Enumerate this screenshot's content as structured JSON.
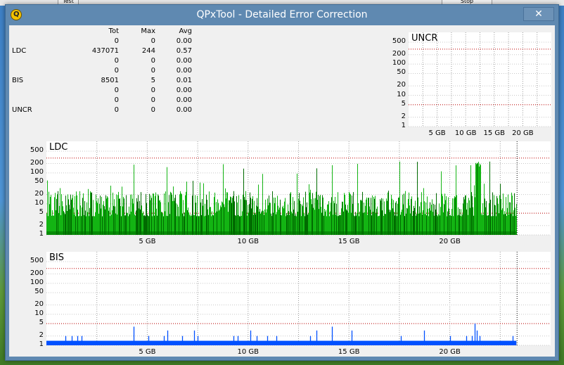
{
  "window": {
    "title": "QPxTool - Detailed Error Correction",
    "close_glyph": "✕"
  },
  "background": {
    "test_label": "Test",
    "right_button_label": "Stop"
  },
  "stats": {
    "headers": {
      "tot": "Tot",
      "max": "Max",
      "avg": "Avg"
    },
    "rows": [
      {
        "label": "",
        "tot": "0",
        "max": "0",
        "avg": "0.00"
      },
      {
        "label": "LDC",
        "tot": "437071",
        "max": "244",
        "avg": "0.57"
      },
      {
        "label": "",
        "tot": "0",
        "max": "0",
        "avg": "0.00"
      },
      {
        "label": "",
        "tot": "0",
        "max": "0",
        "avg": "0.00"
      },
      {
        "label": "BIS",
        "tot": "8501",
        "max": "5",
        "avg": "0.01"
      },
      {
        "label": "",
        "tot": "0",
        "max": "0",
        "avg": "0.00"
      },
      {
        "label": "",
        "tot": "0",
        "max": "0",
        "avg": "0.00"
      },
      {
        "label": "UNCR",
        "tot": "0",
        "max": "0",
        "avg": "0.00"
      }
    ]
  },
  "chart_data": [
    {
      "type": "bar",
      "title": "UNCR",
      "scale": "log",
      "ylim": [
        1,
        500
      ],
      "yticks": [
        "500",
        "200",
        "100",
        "50",
        "20",
        "10",
        "5",
        "2",
        "1"
      ],
      "xticks": [
        "5 GB",
        "10 GB",
        "15 GB",
        "20 GB"
      ],
      "xlim_gb": [
        0,
        25
      ],
      "threshold_lines": [
        300,
        5
      ],
      "values": "all zero",
      "color": "#000000"
    },
    {
      "type": "bar",
      "title": "LDC",
      "scale": "log",
      "ylim": [
        1,
        500
      ],
      "yticks": [
        "500",
        "200",
        "100",
        "50",
        "20",
        "10",
        "5",
        "2",
        "1"
      ],
      "xticks": [
        "5 GB",
        "10 GB",
        "15 GB",
        "20 GB"
      ],
      "xlim_gb": [
        0,
        25
      ],
      "data_end_gb": 23.3,
      "max": 244,
      "typical_range": [
        4,
        30
      ],
      "threshold_lines": [
        300,
        5
      ],
      "colors": {
        "bar": "#13b413",
        "bar_dark": "#006b00"
      }
    },
    {
      "type": "bar",
      "title": "BIS",
      "scale": "log",
      "ylim": [
        1,
        500
      ],
      "yticks": [
        "500",
        "200",
        "100",
        "50",
        "20",
        "10",
        "5",
        "2",
        "1"
      ],
      "xticks": [
        "5 GB",
        "10 GB",
        "15 GB",
        "20 GB"
      ],
      "xlim_gb": [
        0,
        25
      ],
      "data_end_gb": 23.3,
      "max": 5,
      "typical_value": 1,
      "threshold_lines": [
        300,
        5
      ],
      "colors": {
        "bar": "#0050ff"
      }
    }
  ]
}
